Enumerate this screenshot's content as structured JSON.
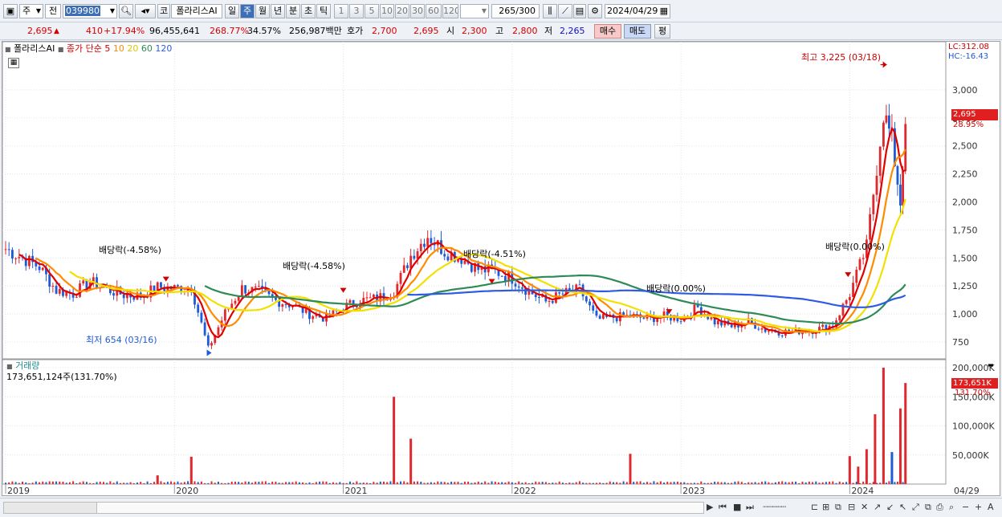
{
  "toolbar": {
    "market_type": "주",
    "period_type": "전",
    "code": "039980",
    "code_prefix": "코",
    "stock_name": "폴라리스AI",
    "periods": [
      "일",
      "주",
      "월",
      "년",
      "분",
      "초",
      "틱"
    ],
    "selected_period": "주",
    "intervals": [
      "1",
      "3",
      "5",
      "10",
      "20",
      "30",
      "60",
      "120"
    ],
    "count_current": "265",
    "count_total": "/300",
    "date": "2024/04/29"
  },
  "quote": {
    "price": "2,695",
    "change": "410",
    "change_pct": "+17.94%",
    "volume": "96,455,641",
    "volume_ratio": "268.77%",
    "turnover": "34.57%",
    "amount": "256,987백만",
    "ask_label": "호가",
    "ask1": "2,700",
    "ask2": "2,695",
    "open_label": "시",
    "open": "2,300",
    "high_label": "고",
    "high": "2,800",
    "low_label": "저",
    "low": "2,265",
    "buy_label": "매수",
    "sell_label": "매도",
    "eval_label": "평"
  },
  "legend": {
    "stock": "폴라리스AI",
    "close_label": "종가 단순",
    "ma5": "5",
    "ma10": "10",
    "ma20": "20",
    "ma60": "60",
    "ma120": "120"
  },
  "colors": {
    "up": "#e0282e",
    "down": "#1f5bd6",
    "ma5": "#e00000",
    "ma10": "#ff8c00",
    "ma20": "#f2e000",
    "ma60": "#2e8b57",
    "ma120": "#2e5be6"
  },
  "price_axis": {
    "lc": "LC:312.08",
    "hc": "HC:-16.43",
    "ticks": [
      "3,000",
      "2,750",
      "2,500",
      "2,250",
      "2,000",
      "1,750",
      "1,500",
      "1,250",
      "1,000",
      "750"
    ],
    "current": "2,695",
    "current_pct": "28.95%"
  },
  "volume_panel": {
    "title": "거래량",
    "summary": "173,651,124주(131.70%)",
    "ticks": [
      "200,000K",
      "150,000K",
      "100,000K",
      "50,000K"
    ],
    "current": "173,651K",
    "current_pct": "131.70%"
  },
  "time_axis": {
    "labels": [
      "2019",
      "2020",
      "2021",
      "2022",
      "2023",
      "2024"
    ],
    "last": "04/29"
  },
  "annotations": {
    "high": "최고 3,225 (03/18)",
    "low": "최저 654 (03/16)",
    "div1": "배당락(-4.58%)",
    "div2": "배당락(-4.58%)",
    "div3": "배당락(-4.51%)",
    "div4": "배당락(0.00%)",
    "div5": "배당락(0.00%)"
  },
  "chart_data": {
    "type": "candlestick",
    "interval": "weekly",
    "ylim": [
      600,
      3300
    ],
    "weekly_close": [
      [
        2019.0,
        1580
      ],
      [
        2019.1,
        1500
      ],
      [
        2019.2,
        1420
      ],
      [
        2019.3,
        1210
      ],
      [
        2019.4,
        1180
      ],
      [
        2019.5,
        1290
      ],
      [
        2019.6,
        1220
      ],
      [
        2019.7,
        1170
      ],
      [
        2019.8,
        1160
      ],
      [
        2019.9,
        1240
      ],
      [
        2020.0,
        1230
      ],
      [
        2020.1,
        1240
      ],
      [
        2020.2,
        690
      ],
      [
        2020.3,
        1010
      ],
      [
        2020.4,
        1230
      ],
      [
        2020.5,
        1200
      ],
      [
        2020.6,
        1120
      ],
      [
        2020.7,
        1080
      ],
      [
        2020.8,
        1000
      ],
      [
        2020.9,
        960
      ],
      [
        2021.0,
        1060
      ],
      [
        2021.1,
        1120
      ],
      [
        2021.2,
        1140
      ],
      [
        2021.3,
        1200
      ],
      [
        2021.4,
        1520
      ],
      [
        2021.5,
        1700
      ],
      [
        2021.6,
        1560
      ],
      [
        2021.7,
        1500
      ],
      [
        2021.8,
        1400
      ],
      [
        2021.9,
        1380
      ],
      [
        2022.0,
        1320
      ],
      [
        2022.1,
        1200
      ],
      [
        2022.2,
        1110
      ],
      [
        2022.3,
        1180
      ],
      [
        2022.4,
        1220
      ],
      [
        2022.5,
        950
      ],
      [
        2022.6,
        970
      ],
      [
        2022.7,
        980
      ],
      [
        2022.8,
        960
      ],
      [
        2022.9,
        980
      ],
      [
        2023.0,
        960
      ],
      [
        2023.1,
        1060
      ],
      [
        2023.2,
        930
      ],
      [
        2023.3,
        890
      ],
      [
        2023.4,
        930
      ],
      [
        2023.5,
        860
      ],
      [
        2023.6,
        840
      ],
      [
        2023.7,
        850
      ],
      [
        2023.8,
        860
      ],
      [
        2023.9,
        900
      ],
      [
        2024.0,
        1180
      ],
      [
        2024.1,
        1600
      ],
      [
        2024.2,
        2800
      ],
      [
        2024.25,
        2550
      ],
      [
        2024.3,
        2000
      ],
      [
        2024.33,
        2695
      ]
    ],
    "ma_last": {
      "5": 2100,
      "10": 2150,
      "20": 1700,
      "60": 1170,
      "120": 1090
    },
    "volume_spikes_k": [
      [
        2019.9,
        15000
      ],
      [
        2020.1,
        47000
      ],
      [
        2021.3,
        150000
      ],
      [
        2021.4,
        78000
      ],
      [
        2022.7,
        52000
      ],
      [
        2024.0,
        48000
      ],
      [
        2024.05,
        30000
      ],
      [
        2024.1,
        60000
      ],
      [
        2024.15,
        120000
      ],
      [
        2024.2,
        200000
      ],
      [
        2024.25,
        55000
      ],
      [
        2024.3,
        130000
      ],
      [
        2024.33,
        173651
      ]
    ],
    "volume_ylim": [
      0,
      200000
    ]
  }
}
